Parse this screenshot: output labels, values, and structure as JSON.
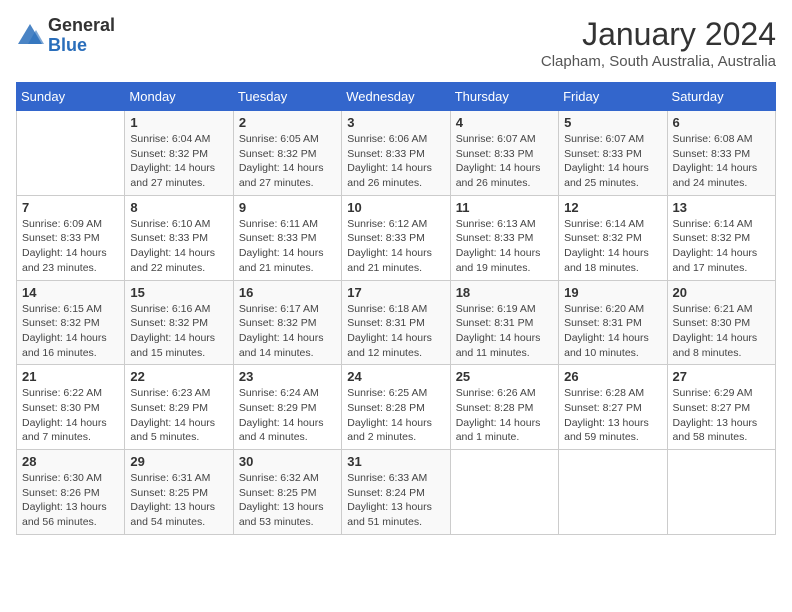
{
  "header": {
    "logo_general": "General",
    "logo_blue": "Blue",
    "title": "January 2024",
    "location": "Clapham, South Australia, Australia"
  },
  "calendar": {
    "days_of_week": [
      "Sunday",
      "Monday",
      "Tuesday",
      "Wednesday",
      "Thursday",
      "Friday",
      "Saturday"
    ],
    "weeks": [
      [
        {
          "day": "",
          "info": ""
        },
        {
          "day": "1",
          "info": "Sunrise: 6:04 AM\nSunset: 8:32 PM\nDaylight: 14 hours\nand 27 minutes."
        },
        {
          "day": "2",
          "info": "Sunrise: 6:05 AM\nSunset: 8:32 PM\nDaylight: 14 hours\nand 27 minutes."
        },
        {
          "day": "3",
          "info": "Sunrise: 6:06 AM\nSunset: 8:33 PM\nDaylight: 14 hours\nand 26 minutes."
        },
        {
          "day": "4",
          "info": "Sunrise: 6:07 AM\nSunset: 8:33 PM\nDaylight: 14 hours\nand 26 minutes."
        },
        {
          "day": "5",
          "info": "Sunrise: 6:07 AM\nSunset: 8:33 PM\nDaylight: 14 hours\nand 25 minutes."
        },
        {
          "day": "6",
          "info": "Sunrise: 6:08 AM\nSunset: 8:33 PM\nDaylight: 14 hours\nand 24 minutes."
        }
      ],
      [
        {
          "day": "7",
          "info": "Sunrise: 6:09 AM\nSunset: 8:33 PM\nDaylight: 14 hours\nand 23 minutes."
        },
        {
          "day": "8",
          "info": "Sunrise: 6:10 AM\nSunset: 8:33 PM\nDaylight: 14 hours\nand 22 minutes."
        },
        {
          "day": "9",
          "info": "Sunrise: 6:11 AM\nSunset: 8:33 PM\nDaylight: 14 hours\nand 21 minutes."
        },
        {
          "day": "10",
          "info": "Sunrise: 6:12 AM\nSunset: 8:33 PM\nDaylight: 14 hours\nand 21 minutes."
        },
        {
          "day": "11",
          "info": "Sunrise: 6:13 AM\nSunset: 8:33 PM\nDaylight: 14 hours\nand 19 minutes."
        },
        {
          "day": "12",
          "info": "Sunrise: 6:14 AM\nSunset: 8:32 PM\nDaylight: 14 hours\nand 18 minutes."
        },
        {
          "day": "13",
          "info": "Sunrise: 6:14 AM\nSunset: 8:32 PM\nDaylight: 14 hours\nand 17 minutes."
        }
      ],
      [
        {
          "day": "14",
          "info": "Sunrise: 6:15 AM\nSunset: 8:32 PM\nDaylight: 14 hours\nand 16 minutes."
        },
        {
          "day": "15",
          "info": "Sunrise: 6:16 AM\nSunset: 8:32 PM\nDaylight: 14 hours\nand 15 minutes."
        },
        {
          "day": "16",
          "info": "Sunrise: 6:17 AM\nSunset: 8:32 PM\nDaylight: 14 hours\nand 14 minutes."
        },
        {
          "day": "17",
          "info": "Sunrise: 6:18 AM\nSunset: 8:31 PM\nDaylight: 14 hours\nand 12 minutes."
        },
        {
          "day": "18",
          "info": "Sunrise: 6:19 AM\nSunset: 8:31 PM\nDaylight: 14 hours\nand 11 minutes."
        },
        {
          "day": "19",
          "info": "Sunrise: 6:20 AM\nSunset: 8:31 PM\nDaylight: 14 hours\nand 10 minutes."
        },
        {
          "day": "20",
          "info": "Sunrise: 6:21 AM\nSunset: 8:30 PM\nDaylight: 14 hours\nand 8 minutes."
        }
      ],
      [
        {
          "day": "21",
          "info": "Sunrise: 6:22 AM\nSunset: 8:30 PM\nDaylight: 14 hours\nand 7 minutes."
        },
        {
          "day": "22",
          "info": "Sunrise: 6:23 AM\nSunset: 8:29 PM\nDaylight: 14 hours\nand 5 minutes."
        },
        {
          "day": "23",
          "info": "Sunrise: 6:24 AM\nSunset: 8:29 PM\nDaylight: 14 hours\nand 4 minutes."
        },
        {
          "day": "24",
          "info": "Sunrise: 6:25 AM\nSunset: 8:28 PM\nDaylight: 14 hours\nand 2 minutes."
        },
        {
          "day": "25",
          "info": "Sunrise: 6:26 AM\nSunset: 8:28 PM\nDaylight: 14 hours\nand 1 minute."
        },
        {
          "day": "26",
          "info": "Sunrise: 6:28 AM\nSunset: 8:27 PM\nDaylight: 13 hours\nand 59 minutes."
        },
        {
          "day": "27",
          "info": "Sunrise: 6:29 AM\nSunset: 8:27 PM\nDaylight: 13 hours\nand 58 minutes."
        }
      ],
      [
        {
          "day": "28",
          "info": "Sunrise: 6:30 AM\nSunset: 8:26 PM\nDaylight: 13 hours\nand 56 minutes."
        },
        {
          "day": "29",
          "info": "Sunrise: 6:31 AM\nSunset: 8:25 PM\nDaylight: 13 hours\nand 54 minutes."
        },
        {
          "day": "30",
          "info": "Sunrise: 6:32 AM\nSunset: 8:25 PM\nDaylight: 13 hours\nand 53 minutes."
        },
        {
          "day": "31",
          "info": "Sunrise: 6:33 AM\nSunset: 8:24 PM\nDaylight: 13 hours\nand 51 minutes."
        },
        {
          "day": "",
          "info": ""
        },
        {
          "day": "",
          "info": ""
        },
        {
          "day": "",
          "info": ""
        }
      ]
    ]
  }
}
